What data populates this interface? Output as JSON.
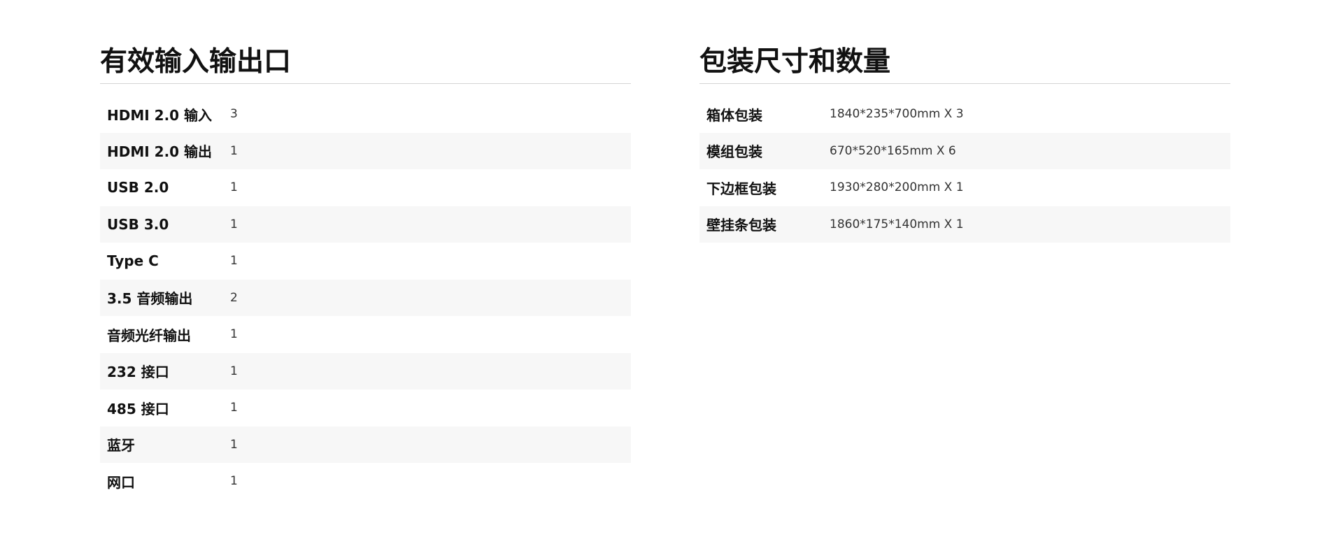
{
  "io_section": {
    "title": "有效输入输出口",
    "rows": [
      {
        "label": "HDMI 2.0 输入",
        "value": "3"
      },
      {
        "label": "HDMI 2.0 输出",
        "value": "1"
      },
      {
        "label": "USB 2.0",
        "value": "1"
      },
      {
        "label": "USB 3.0",
        "value": "1"
      },
      {
        "label": "Type C",
        "value": "1"
      },
      {
        "label": "3.5 音频输出",
        "value": "2"
      },
      {
        "label": "音频光纤输出",
        "value": "1"
      },
      {
        "label": "232 接口",
        "value": "1"
      },
      {
        "label": "485 接口",
        "value": "1"
      },
      {
        "label": "蓝牙",
        "value": "1"
      },
      {
        "label": "网口",
        "value": "1"
      }
    ]
  },
  "packaging_section": {
    "title": "包装尺寸和数量",
    "rows": [
      {
        "label": "箱体包装",
        "value": "1840*235*700mm X 3"
      },
      {
        "label": "模组包装",
        "value": "670*520*165mm X 6"
      },
      {
        "label": "下边框包装",
        "value": "1930*280*200mm X 1"
      },
      {
        "label": "壁挂条包装",
        "value": "1860*175*140mm X 1"
      }
    ]
  }
}
